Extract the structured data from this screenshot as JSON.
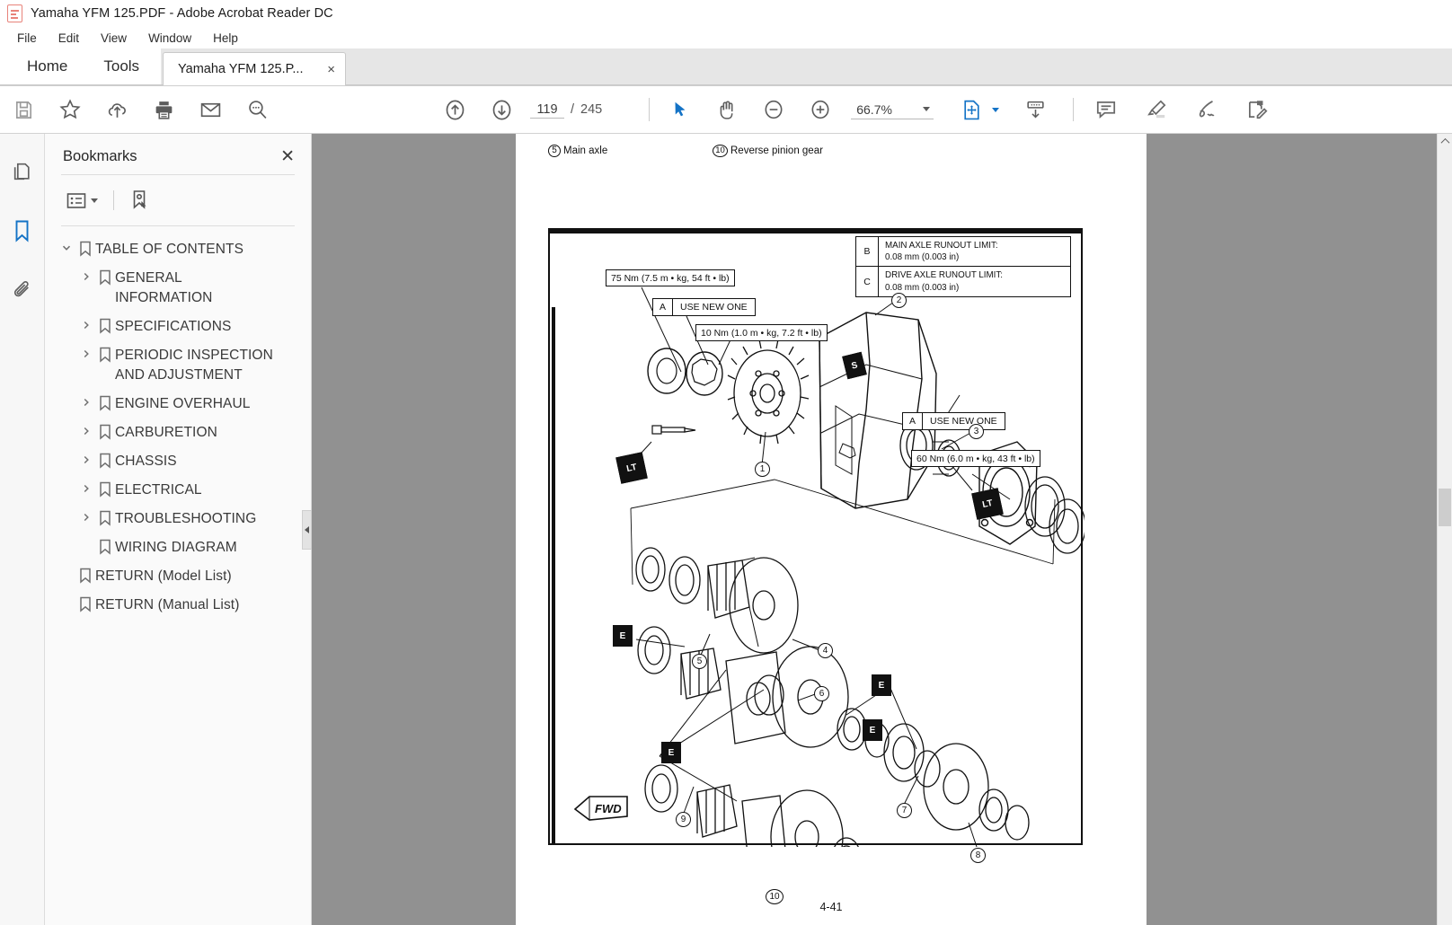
{
  "window": {
    "title": "Yamaha YFM 125.PDF - Adobe Acrobat Reader DC",
    "app_icon": "pdf-document-icon"
  },
  "menubar": {
    "items": [
      {
        "label": "File"
      },
      {
        "label": "Edit"
      },
      {
        "label": "View"
      },
      {
        "label": "Window"
      },
      {
        "label": "Help"
      }
    ]
  },
  "tabstrip": {
    "home_label": "Home",
    "tools_label": "Tools",
    "document_tab_label": "Yamaha YFM 125.P...",
    "close_glyph": "×"
  },
  "toolbar": {
    "left_tools": [
      {
        "name": "save-file-icon",
        "tooltip": "Save File"
      },
      {
        "name": "star-icon",
        "tooltip": "Add to Favorites"
      },
      {
        "name": "upload-cloud-icon",
        "tooltip": "Share File"
      },
      {
        "name": "print-icon",
        "tooltip": "Print File"
      },
      {
        "name": "email-icon",
        "tooltip": "Email File"
      },
      {
        "name": "search-icon",
        "tooltip": "Find"
      }
    ],
    "nav": {
      "previous_page_icon": "arrow-up-circle-icon",
      "next_page_icon": "arrow-down-circle-icon",
      "current_page": "119",
      "separator": "/",
      "total_pages": "245"
    },
    "view": {
      "select_tool_icon": "cursor-arrow-icon",
      "hand_tool_icon": "hand-icon",
      "zoom_out_icon": "minus-circle-icon",
      "zoom_in_icon": "plus-circle-icon",
      "zoom_level": "66.7%",
      "zoom_dropdown_icon": "chevron-down-icon",
      "fit_page_icon": "fit-page-icon",
      "fit_page_dropdown_icon": "chevron-down-icon",
      "scroll_mode_icon": "page-scroll-icon"
    },
    "annotate": [
      {
        "name": "comment-icon",
        "tooltip": "Add Comment"
      },
      {
        "name": "highlighter-icon",
        "tooltip": "Highlight Text"
      },
      {
        "name": "signature-icon",
        "tooltip": "Fill & Sign"
      },
      {
        "name": "edit-pdf-icon",
        "tooltip": "Edit PDF"
      }
    ]
  },
  "navrail": {
    "items": [
      {
        "name": "page-thumbnails-icon",
        "label": "Page Thumbnails",
        "active": false
      },
      {
        "name": "bookmarks-icon",
        "label": "Bookmarks",
        "active": true
      },
      {
        "name": "attachments-icon",
        "label": "Attachments",
        "active": false
      }
    ]
  },
  "bookmarks_panel": {
    "title": "Bookmarks",
    "close_glyph": "✕",
    "options_icon": "bookmark-options-icon",
    "new_bookmark_icon": "new-bookmark-icon",
    "collapse_handle_icon": "collapse-panel-icon",
    "items": [
      {
        "label": "TABLE OF CONTENTS",
        "level": 0,
        "expanded": true,
        "has_children": true
      },
      {
        "label": "GENERAL INFORMATION",
        "level": 1,
        "expanded": false,
        "has_children": true
      },
      {
        "label": "SPECIFICATIONS",
        "level": 1,
        "expanded": false,
        "has_children": true
      },
      {
        "label": "PERIODIC INSPECTION AND ADJUSTMENT",
        "level": 1,
        "expanded": false,
        "has_children": true
      },
      {
        "label": "ENGINE OVERHAUL",
        "level": 1,
        "expanded": false,
        "has_children": true
      },
      {
        "label": "CARBURETION",
        "level": 1,
        "expanded": false,
        "has_children": true
      },
      {
        "label": "CHASSIS",
        "level": 1,
        "expanded": false,
        "has_children": true
      },
      {
        "label": "ELECTRICAL",
        "level": 1,
        "expanded": false,
        "has_children": true
      },
      {
        "label": "TROUBLESHOOTING",
        "level": 1,
        "expanded": false,
        "has_children": true
      },
      {
        "label": "WIRING DIAGRAM",
        "level": 1,
        "expanded": false,
        "has_children": false
      },
      {
        "label": "RETURN (Model List)",
        "level": 0,
        "expanded": false,
        "has_children": false
      },
      {
        "label": "RETURN (Manual List)",
        "level": 0,
        "expanded": false,
        "has_children": false
      }
    ]
  },
  "document_page": {
    "page_label": "4-41",
    "top_captions": [
      {
        "num": "5",
        "text": "Main axle"
      },
      {
        "num": "10",
        "text": "Reverse pinion gear"
      }
    ],
    "torque_labels": [
      {
        "text": "75 Nm (7.5 m • kg, 54 ft • lb)"
      },
      {
        "text": "10 Nm (1.0 m • kg, 7.2 ft • lb)"
      },
      {
        "text": "60 Nm (6.0 m • kg, 43 ft • lb)"
      }
    ],
    "note_labels": [
      {
        "key": "A",
        "value": "USE NEW ONE"
      },
      {
        "key": "A",
        "value": "USE NEW ONE"
      }
    ],
    "spec_table": [
      {
        "key": "B",
        "title": "MAIN AXLE RUNOUT LIMIT:",
        "value": "0.08 mm (0.003 in)"
      },
      {
        "key": "C",
        "title": "DRIVE AXLE RUNOUT LIMIT:",
        "value": "0.08 mm (0.003 in)"
      }
    ],
    "callout_numbers": [
      "1",
      "2",
      "3",
      "4",
      "5",
      "6",
      "7",
      "8",
      "9",
      "10"
    ],
    "marker_tags": [
      {
        "label": "LT"
      },
      {
        "label": "LT"
      },
      {
        "label": "E"
      },
      {
        "label": "E"
      },
      {
        "label": "E"
      },
      {
        "label": "E"
      },
      {
        "label": "S"
      }
    ],
    "direction_marker": "FWD"
  },
  "scrollbar": {
    "up_arrow_icon": "chevron-up-icon",
    "down_arrow_icon": "chevron-down-icon"
  },
  "colors": {
    "accent": "#1473c6",
    "chrome": "#f7f7f7",
    "viewer_bg": "#919191",
    "text": "#2b2b2b"
  }
}
